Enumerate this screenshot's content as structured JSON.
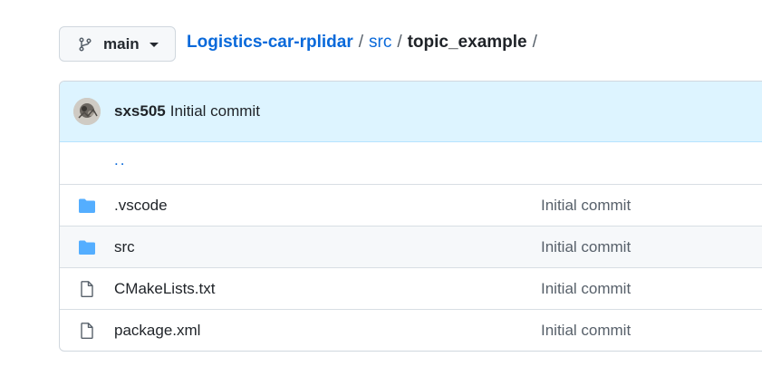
{
  "branch": {
    "name": "main",
    "icon": "git-branch-icon"
  },
  "breadcrumb": {
    "repo": "Logistics-car-rplidar",
    "sep1": "/",
    "dir": "src",
    "sep2": "/",
    "current": "topic_example",
    "sep3": "/"
  },
  "latest_commit": {
    "author": "sxs505",
    "message": "Initial commit"
  },
  "parent_link": "..",
  "files": [
    {
      "name": ".vscode",
      "type": "folder",
      "icon": "folder-icon",
      "commit_message": "Initial commit"
    },
    {
      "name": "src",
      "type": "folder",
      "icon": "folder-icon",
      "commit_message": "Initial commit"
    },
    {
      "name": "CMakeLists.txt",
      "type": "file",
      "icon": "file-icon",
      "commit_message": "Initial commit"
    },
    {
      "name": "package.xml",
      "type": "file",
      "icon": "file-icon",
      "commit_message": "Initial commit"
    }
  ],
  "colors": {
    "link": "#0969da",
    "folder": "#54aeff",
    "header_bg": "#ddf4ff"
  }
}
